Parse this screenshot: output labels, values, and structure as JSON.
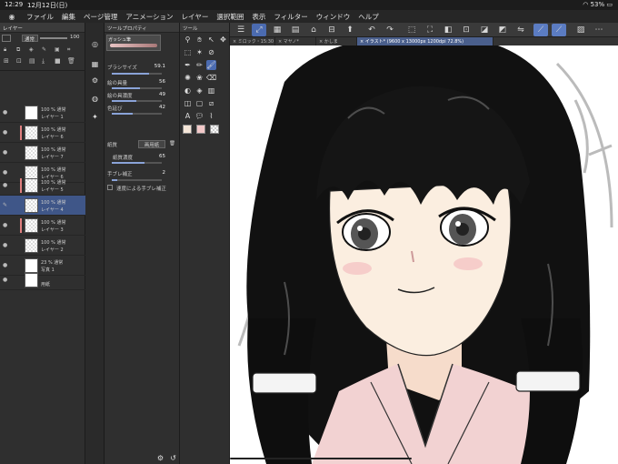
{
  "status": {
    "time": "12:29",
    "date": "12月12日(日)",
    "battery": "53%"
  },
  "menu": [
    "ファイル",
    "編集",
    "ページ管理",
    "アニメーション",
    "レイヤー",
    "選択範囲",
    "表示",
    "フィルター",
    "ウィンドウ",
    "ヘルプ"
  ],
  "layer_panel": {
    "title": "レイヤー",
    "blend": "通常",
    "opacity": "100",
    "layers": [
      {
        "pct": "100 % 通常",
        "name": "レイヤー 1",
        "mark": false,
        "solid": true
      },
      {
        "pct": "100 % 通常",
        "name": "レイヤー 6",
        "mark": true,
        "solid": false
      },
      {
        "pct": "100 % 通常",
        "name": "レイヤー 7",
        "mark": false,
        "solid": false
      },
      {
        "pct": "100 % 通常",
        "name": "レイヤー 6",
        "mark": false,
        "solid": false
      },
      {
        "pct": "100 % 通常",
        "name": "レイヤー 5",
        "mark": true,
        "solid": false
      },
      {
        "pct": "100 % 通常",
        "name": "レイヤー 4",
        "mark": false,
        "solid": false,
        "selected": true
      },
      {
        "pct": "100 % 通常",
        "name": "レイヤー 3",
        "mark": true,
        "solid": false
      },
      {
        "pct": "100 % 通常",
        "name": "レイヤー 2",
        "mark": false,
        "solid": false
      },
      {
        "pct": "23 % 通常",
        "name": "写真 1",
        "mark": false,
        "solid": true
      },
      {
        "pct": "",
        "name": "用紙",
        "mark": false,
        "solid": true
      }
    ]
  },
  "tool_property": {
    "title": "ツールプロパティ",
    "sub_tool": "ガッシュ筆",
    "brush_size_label": "ブラシサイズ",
    "brush_size": "59.1",
    "rows": [
      {
        "label": "絵の具量",
        "value": "56"
      },
      {
        "label": "絵の具濃度",
        "value": "49"
      },
      {
        "label": "色延び",
        "value": "42"
      }
    ],
    "paper_label": "紙質",
    "paper_btn": "画用紙",
    "paper_density_label": "紙質濃度",
    "paper_density": "65",
    "stabilizer_label": "手ブレ補正",
    "stabilizer": "2",
    "speed_label": "速度による手ブレ補正"
  },
  "tool_panel": {
    "title": "ツール"
  },
  "tabs": [
    {
      "label": "ミロック・15:30"
    },
    {
      "label": "マヤノ*"
    },
    {
      "label": "かしま"
    },
    {
      "label": "イラスト* (9600 x 13000px 1200dpi 72.8%)",
      "current": true
    }
  ],
  "colors": {
    "accent": "#4b6bb0",
    "skin": "#fbeee0",
    "hair": "#111111",
    "kimono": "#f2d2d2"
  }
}
